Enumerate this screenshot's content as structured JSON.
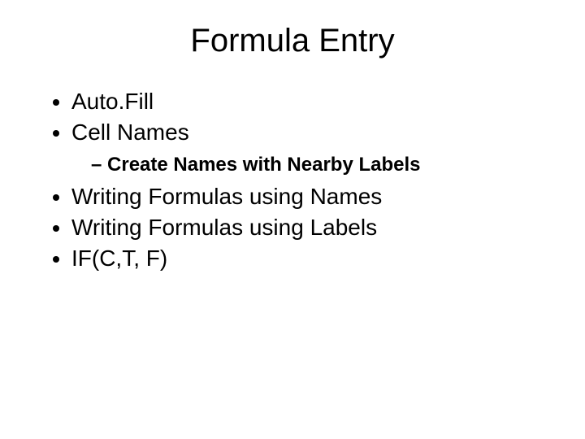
{
  "title": "Formula Entry",
  "bullets": {
    "b1": "Auto.Fill",
    "b2": "Cell Names",
    "b2_sub1": "Create Names with Nearby Labels",
    "b3": "Writing Formulas using Names",
    "b4": "Writing Formulas using Labels",
    "b5": "IF(C,T, F)"
  }
}
